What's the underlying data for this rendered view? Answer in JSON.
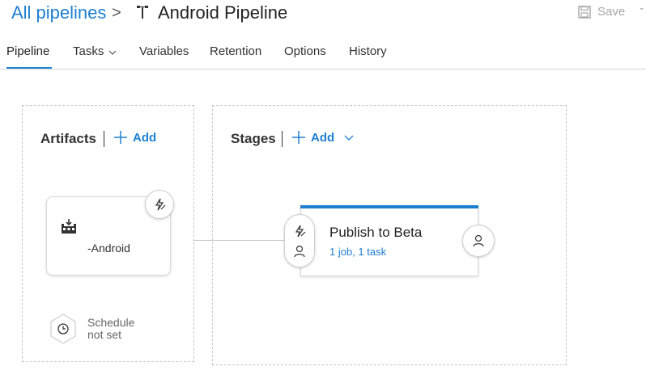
{
  "header": {
    "breadcrumb_link": "All pipelines",
    "breadcrumb_sep": ">",
    "title": "Android Pipeline",
    "save_label": "Save",
    "more_label": "-"
  },
  "tabs": [
    {
      "label": "Pipeline",
      "active": true
    },
    {
      "label": "Tasks",
      "has_dropdown": true
    },
    {
      "label": "Variables"
    },
    {
      "label": "Retention"
    },
    {
      "label": "Options"
    },
    {
      "label": "History"
    }
  ],
  "artifacts": {
    "title": "Artifacts",
    "add_label": "Add",
    "card": {
      "name": "-Android",
      "icon": "build-factory-icon",
      "trigger_icon": "lightning-icon"
    },
    "schedule": {
      "line1": "Schedule",
      "line2": "not set",
      "icon": "clock-icon"
    }
  },
  "stages": {
    "title": "Stages",
    "add_label": "Add",
    "card": {
      "name": "Publish to Beta",
      "summary": "1 job, 1 task",
      "pre_icons": [
        "lightning-icon",
        "person-icon"
      ],
      "post_icon": "person-icon"
    }
  },
  "colors": {
    "accent": "#1e7fd0",
    "text": "#333333",
    "muted": "#a6a6a6",
    "border": "#c8c8c8"
  }
}
